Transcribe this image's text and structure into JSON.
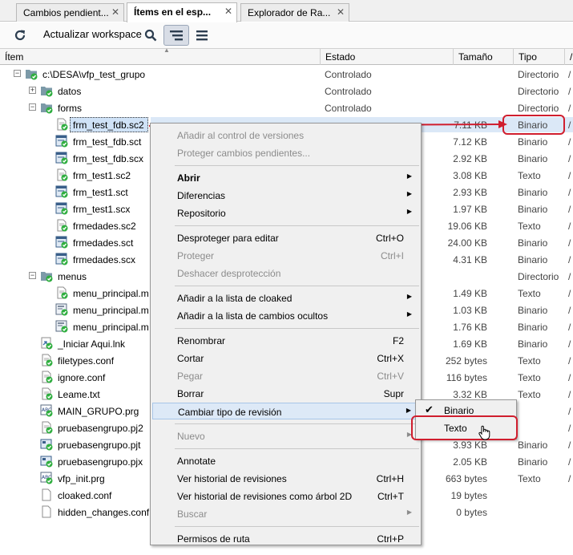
{
  "tabs": [
    {
      "label": "Cambios pendient...",
      "active": false
    },
    {
      "label": "Ítems en el esp...",
      "active": true
    },
    {
      "label": "Explorador de Ra...",
      "active": false
    }
  ],
  "toolbar": {
    "refresh_label": "Actualizar workspace"
  },
  "columns": [
    "Ítem",
    "Estado",
    "Tamaño",
    "Tipo",
    "/"
  ],
  "rows": [
    {
      "name": "c:\\DESA\\vfp_test_grupo",
      "estado": "Controlado",
      "tam": "",
      "tipo": "Directorio",
      "ext": "/",
      "icon": "folder-icon",
      "level": 0,
      "expander": "−"
    },
    {
      "name": "datos",
      "estado": "Controlado",
      "tam": "",
      "tipo": "Directorio",
      "ext": "/",
      "icon": "folder-icon",
      "level": 1,
      "expander": "+"
    },
    {
      "name": "forms",
      "estado": "Controlado",
      "tam": "",
      "tipo": "Directorio",
      "ext": "/",
      "icon": "folder-icon",
      "level": 1,
      "expander": "−"
    },
    {
      "name": "frm_test_fdb.sc2",
      "estado": "",
      "tam": "7.11 KB",
      "tipo": "Binario",
      "ext": "/",
      "icon": "text-file-icon",
      "level": 2,
      "selected": true
    },
    {
      "name": "frm_test_fdb.sct",
      "estado": "",
      "tam": "7.12 KB",
      "tipo": "Binario",
      "ext": "/",
      "icon": "form-file-icon",
      "level": 2
    },
    {
      "name": "frm_test_fdb.scx",
      "estado": "",
      "tam": "2.92 KB",
      "tipo": "Binario",
      "ext": "/",
      "icon": "form-file-icon",
      "level": 2
    },
    {
      "name": "frm_test1.sc2",
      "estado": "",
      "tam": "3.08 KB",
      "tipo": "Texto",
      "ext": "/",
      "icon": "text-file-icon",
      "level": 2
    },
    {
      "name": "frm_test1.sct",
      "estado": "",
      "tam": "2.93 KB",
      "tipo": "Binario",
      "ext": "/",
      "icon": "form-file-icon",
      "level": 2
    },
    {
      "name": "frm_test1.scx",
      "estado": "",
      "tam": "1.97 KB",
      "tipo": "Binario",
      "ext": "/",
      "icon": "form-file-icon",
      "level": 2
    },
    {
      "name": "frmedades.sc2",
      "estado": "",
      "tam": "19.06 KB",
      "tipo": "Texto",
      "ext": "/",
      "icon": "text-file-icon",
      "level": 2
    },
    {
      "name": "frmedades.sct",
      "estado": "",
      "tam": "24.00 KB",
      "tipo": "Binario",
      "ext": "/",
      "icon": "form-file-icon",
      "level": 2
    },
    {
      "name": "frmedades.scx",
      "estado": "",
      "tam": "4.31 KB",
      "tipo": "Binario",
      "ext": "/",
      "icon": "form-file-icon",
      "level": 2
    },
    {
      "name": "menus",
      "estado": "",
      "tam": "",
      "tipo": "Directorio",
      "ext": "/",
      "icon": "folder-icon",
      "level": 1,
      "expander": "−"
    },
    {
      "name": "menu_principal.m",
      "estado": "",
      "tam": "1.49 KB",
      "tipo": "Texto",
      "ext": "/",
      "icon": "text-file-icon",
      "level": 2
    },
    {
      "name": "menu_principal.m",
      "estado": "",
      "tam": "1.03 KB",
      "tipo": "Binario",
      "ext": "/",
      "icon": "menu-file-icon",
      "level": 2
    },
    {
      "name": "menu_principal.m",
      "estado": "",
      "tam": "1.76 KB",
      "tipo": "Binario",
      "ext": "/",
      "icon": "menu-file-icon",
      "level": 2
    },
    {
      "name": "_Iniciar Aqui.lnk",
      "estado": "",
      "tam": "1.69 KB",
      "tipo": "Binario",
      "ext": "/",
      "icon": "shortcut-file-icon",
      "level": 1
    },
    {
      "name": "filetypes.conf",
      "estado": "",
      "tam": "252 bytes",
      "tipo": "Texto",
      "ext": "/",
      "icon": "text-file-icon",
      "level": 1
    },
    {
      "name": "ignore.conf",
      "estado": "",
      "tam": "116 bytes",
      "tipo": "Texto",
      "ext": "/",
      "icon": "text-file-icon",
      "level": 1
    },
    {
      "name": "Leame.txt",
      "estado": "",
      "tam": "3.32 KB",
      "tipo": "Texto",
      "ext": "/",
      "icon": "text-file-icon",
      "level": 1
    },
    {
      "name": "MAIN_GRUPO.prg",
      "estado": "",
      "tam": "",
      "tipo": "",
      "ext": "/",
      "icon": "program-file-icon",
      "level": 1
    },
    {
      "name": "pruebasengrupo.pj2",
      "estado": "",
      "tam": "",
      "tipo": "",
      "ext": "/",
      "icon": "text-file-icon",
      "level": 1
    },
    {
      "name": "pruebasengrupo.pjt",
      "estado": "",
      "tam": "3.93 KB",
      "tipo": "Binario",
      "ext": "/",
      "icon": "project-file-icon",
      "level": 1
    },
    {
      "name": "pruebasengrupo.pjx",
      "estado": "",
      "tam": "2.05 KB",
      "tipo": "Binario",
      "ext": "/",
      "icon": "project-file-icon",
      "level": 1
    },
    {
      "name": "vfp_init.prg",
      "estado": "",
      "tam": "663 bytes",
      "tipo": "Texto",
      "ext": "/",
      "icon": "program-file-icon",
      "level": 1
    },
    {
      "name": "cloaked.conf",
      "estado": "",
      "tam": "19 bytes",
      "tipo": "",
      "ext": "",
      "icon": "blank-file-icon",
      "level": 1
    },
    {
      "name": "hidden_changes.conf",
      "estado": "",
      "tam": "0 bytes",
      "tipo": "",
      "ext": "",
      "icon": "blank-file-icon",
      "level": 1
    }
  ],
  "context_menu": {
    "items": [
      {
        "label": "Añadir al control de versiones",
        "disabled": true
      },
      {
        "label": "Proteger cambios pendientes...",
        "disabled": true
      },
      {
        "sep": true
      },
      {
        "label": "Abrir",
        "bold": true,
        "submenu": true
      },
      {
        "label": "Diferencias",
        "submenu": true
      },
      {
        "label": "Repositorio",
        "submenu": true
      },
      {
        "sep": true
      },
      {
        "label": "Desproteger para editar",
        "shortcut": "Ctrl+O"
      },
      {
        "label": "Proteger",
        "shortcut": "Ctrl+I",
        "disabled": true
      },
      {
        "label": "Deshacer desprotección",
        "disabled": true
      },
      {
        "sep": true
      },
      {
        "label": "Añadir a la lista de cloaked",
        "submenu": true
      },
      {
        "label": "Añadir a la lista de cambios ocultos",
        "submenu": true
      },
      {
        "sep": true
      },
      {
        "label": "Renombrar",
        "shortcut": "F2"
      },
      {
        "label": "Cortar",
        "shortcut": "Ctrl+X"
      },
      {
        "label": "Pegar",
        "shortcut": "Ctrl+V",
        "disabled": true
      },
      {
        "label": "Borrar",
        "shortcut": "Supr"
      },
      {
        "label": "Cambiar tipo de revisión",
        "submenu": true,
        "hover": true
      },
      {
        "sep": true
      },
      {
        "label": "Nuevo",
        "submenu": true,
        "disabled": true
      },
      {
        "sep": true
      },
      {
        "label": "Annotate"
      },
      {
        "label": "Ver historial de revisiones",
        "shortcut": "Ctrl+H"
      },
      {
        "label": "Ver historial de revisiones como árbol 2D",
        "shortcut": "Ctrl+T"
      },
      {
        "label": "Buscar",
        "submenu": true,
        "disabled": true
      },
      {
        "sep": true
      },
      {
        "label": "Permisos de ruta",
        "shortcut": "Ctrl+P"
      }
    ]
  },
  "submenu": {
    "items": [
      {
        "label": "Binario",
        "checked": true
      },
      {
        "label": "Texto",
        "checked": false
      }
    ]
  },
  "colors": {
    "annotation": "#d01e2e",
    "folder": "#7c9aa8",
    "status_ok": "#2fae3f",
    "selection": "#cfe2f7"
  }
}
